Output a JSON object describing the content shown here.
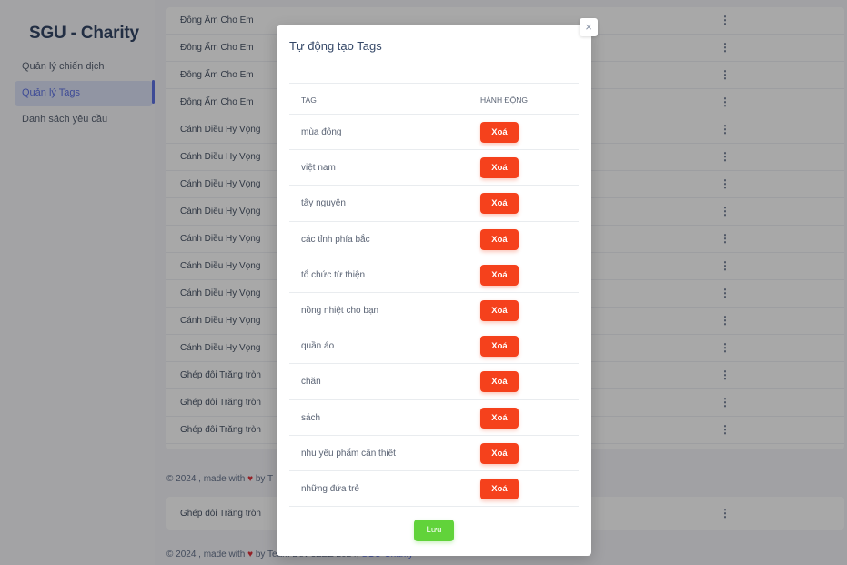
{
  "sidebar": {
    "brand": "SGU - Charity",
    "items": [
      {
        "label": "Quản lý chiến dịch"
      },
      {
        "label": "Quản lý Tags"
      },
      {
        "label": "Danh sách yêu cầu"
      }
    ]
  },
  "background_table": {
    "rows": [
      "Đông Ấm Cho Em",
      "Đông Ấm Cho Em",
      "Đông Ấm Cho Em",
      "Đông Ấm Cho Em",
      "Cánh Diều Hy Vọng",
      "Cánh Diều Hy Vọng",
      "Cánh Diều Hy Vọng",
      "Cánh Diều Hy Vọng",
      "Cánh Diều Hy Vọng",
      "Cánh Diều Hy Vọng",
      "Cánh Diều Hy Vọng",
      "Cánh Diều Hy Vọng",
      "Cánh Diều Hy Vọng",
      "Ghép đôi Trăng tròn",
      "Ghép đôi Trăng tròn",
      "Ghép đôi Trăng tròn"
    ],
    "action_glyph": "⋮",
    "footer": {
      "prefix": "© 2024 , made with",
      "suffix": "by T"
    },
    "extra_row": "Ghép đôi Trăng tròn",
    "footer2": {
      "prefix": "© 2024 , made with",
      "by": "by Team Dev 3ZEE 2024,",
      "brand": "SGU-Charity"
    }
  },
  "modal": {
    "title": "Tự động tạo Tags",
    "close_glyph": "×",
    "headers": {
      "tag": "TAG",
      "action": "HÀNH ĐỘNG"
    },
    "tags": [
      {
        "name": "mùa đông",
        "button": "Xoá"
      },
      {
        "name": "việt nam",
        "button": "Xoá"
      },
      {
        "name": "tây nguyên",
        "button": "Xoá"
      },
      {
        "name": "các tỉnh phía bắc",
        "button": "Xoá"
      },
      {
        "name": "tổ chức từ thiện",
        "button": "Xoá"
      },
      {
        "name": "nồng nhiệt cho bạn",
        "button": "Xoá"
      },
      {
        "name": "quần áo",
        "button": "Xoá"
      },
      {
        "name": "chăn",
        "button": "Xoá"
      },
      {
        "name": "sách",
        "button": "Xoá"
      },
      {
        "name": "nhu yếu phẩm cần thiết",
        "button": "Xoá"
      },
      {
        "name": "những đứa trẻ",
        "button": "Xoá"
      }
    ],
    "save_label": "Lưu"
  },
  "colors": {
    "accent": "#5e72e4",
    "delete": "#f5411c",
    "save": "#61d33a",
    "heart": "#e0313b"
  },
  "icons": {
    "heart": "heart-icon",
    "close": "close-icon",
    "more": "more-vertical-icon"
  }
}
